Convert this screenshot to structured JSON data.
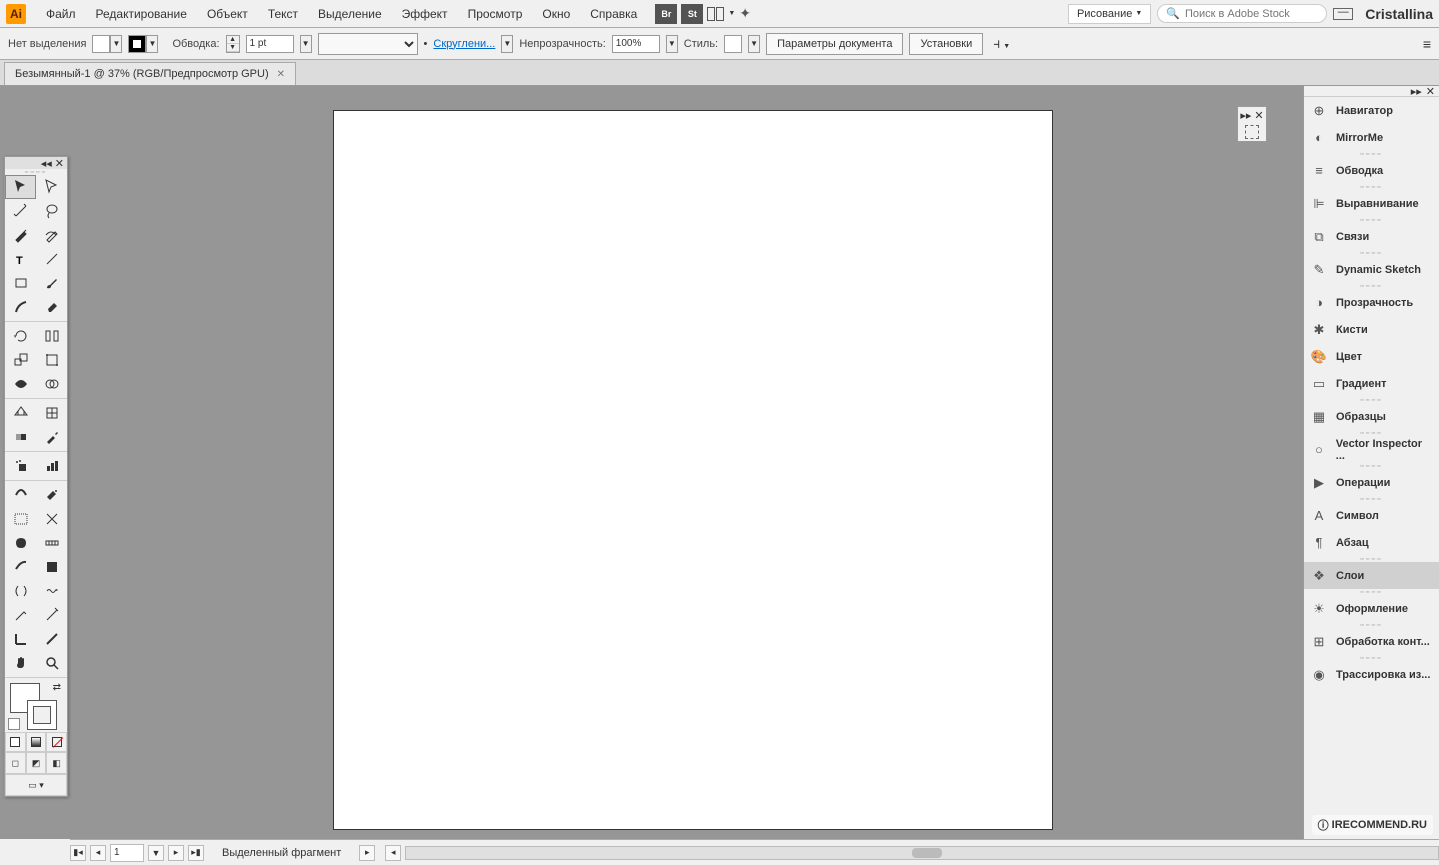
{
  "app": {
    "logo": "Ai",
    "username": "Cristallina"
  },
  "menu": {
    "items": [
      "Файл",
      "Редактирование",
      "Объект",
      "Текст",
      "Выделение",
      "Эффект",
      "Просмотр",
      "Окно",
      "Справка"
    ],
    "badges": [
      "Br",
      "St"
    ],
    "workspace": "Рисование",
    "stock_placeholder": "Поиск в Adobe Stock"
  },
  "controlbar": {
    "no_selection": "Нет выделения",
    "stroke_label": "Обводка:",
    "stroke_val": "1 pt",
    "corner_label": "Скруглени...",
    "opacity_label": "Непрозрачность:",
    "opacity_val": "100%",
    "style_label": "Стиль:",
    "doc_params": "Параметры документа",
    "settings": "Установки"
  },
  "doc": {
    "tab": "Безымянный-1 @ 37% (RGB/Предпросмотр GPU)"
  },
  "panels": [
    {
      "label": "Навигатор",
      "icon": "⊕"
    },
    {
      "label": "MirrorMe",
      "icon": "◐"
    },
    {
      "sep": true
    },
    {
      "label": "Обводка",
      "icon": "≡"
    },
    {
      "sep": true
    },
    {
      "label": "Выравнивание",
      "icon": "⊫"
    },
    {
      "sep": true
    },
    {
      "label": "Связи",
      "icon": "⧉"
    },
    {
      "sep": true
    },
    {
      "label": "Dynamic Sketch",
      "icon": "✎"
    },
    {
      "sep": true
    },
    {
      "label": "Прозрачность",
      "icon": "◑"
    },
    {
      "label": "Кисти",
      "icon": "✱"
    },
    {
      "label": "Цвет",
      "icon": "🎨"
    },
    {
      "label": "Градиент",
      "icon": "▭"
    },
    {
      "sep": true
    },
    {
      "label": "Образцы",
      "icon": "▦"
    },
    {
      "sep": true
    },
    {
      "label": "Vector Inspector ...",
      "icon": "○"
    },
    {
      "sep": true
    },
    {
      "label": "Операции",
      "icon": "▶"
    },
    {
      "sep": true
    },
    {
      "label": "Символ",
      "icon": "A"
    },
    {
      "label": "Абзац",
      "icon": "¶"
    },
    {
      "sep": true
    },
    {
      "label": "Слои",
      "icon": "❖",
      "selected": true
    },
    {
      "sep": true
    },
    {
      "label": "Оформление",
      "icon": "☀"
    },
    {
      "sep": true
    },
    {
      "label": "Обработка конт...",
      "icon": "⊞"
    },
    {
      "sep": true
    },
    {
      "label": "Трассировка из...",
      "icon": "◉"
    }
  ],
  "statusbar": {
    "page": "1",
    "status": "Выделенный фрагмент"
  },
  "watermark": "IRECOMMEND.RU"
}
